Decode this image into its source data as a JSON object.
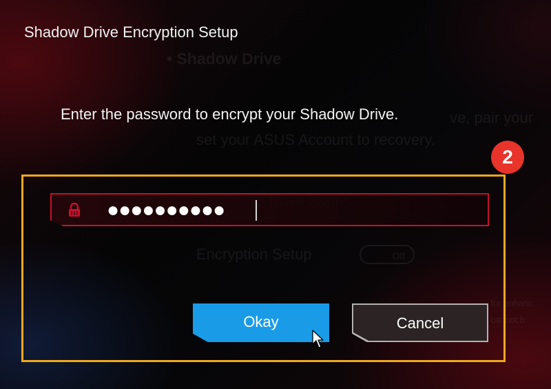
{
  "dialog": {
    "title": "Shadow Drive Encryption Setup",
    "instruction": "Enter the password to encrypt your Shadow Drive.",
    "step_badge": "2",
    "password_field": {
      "icon": "lock-icon",
      "masked_value": "●●●●●●●●●●"
    },
    "buttons": {
      "okay_label": "Okay",
      "cancel_label": "Cancel"
    }
  },
  "colors": {
    "accent_blue": "#1a9be8",
    "field_border_red": "#c8102e",
    "highlight_orange": "#f0a91c",
    "badge_red": "#e8342b"
  }
}
